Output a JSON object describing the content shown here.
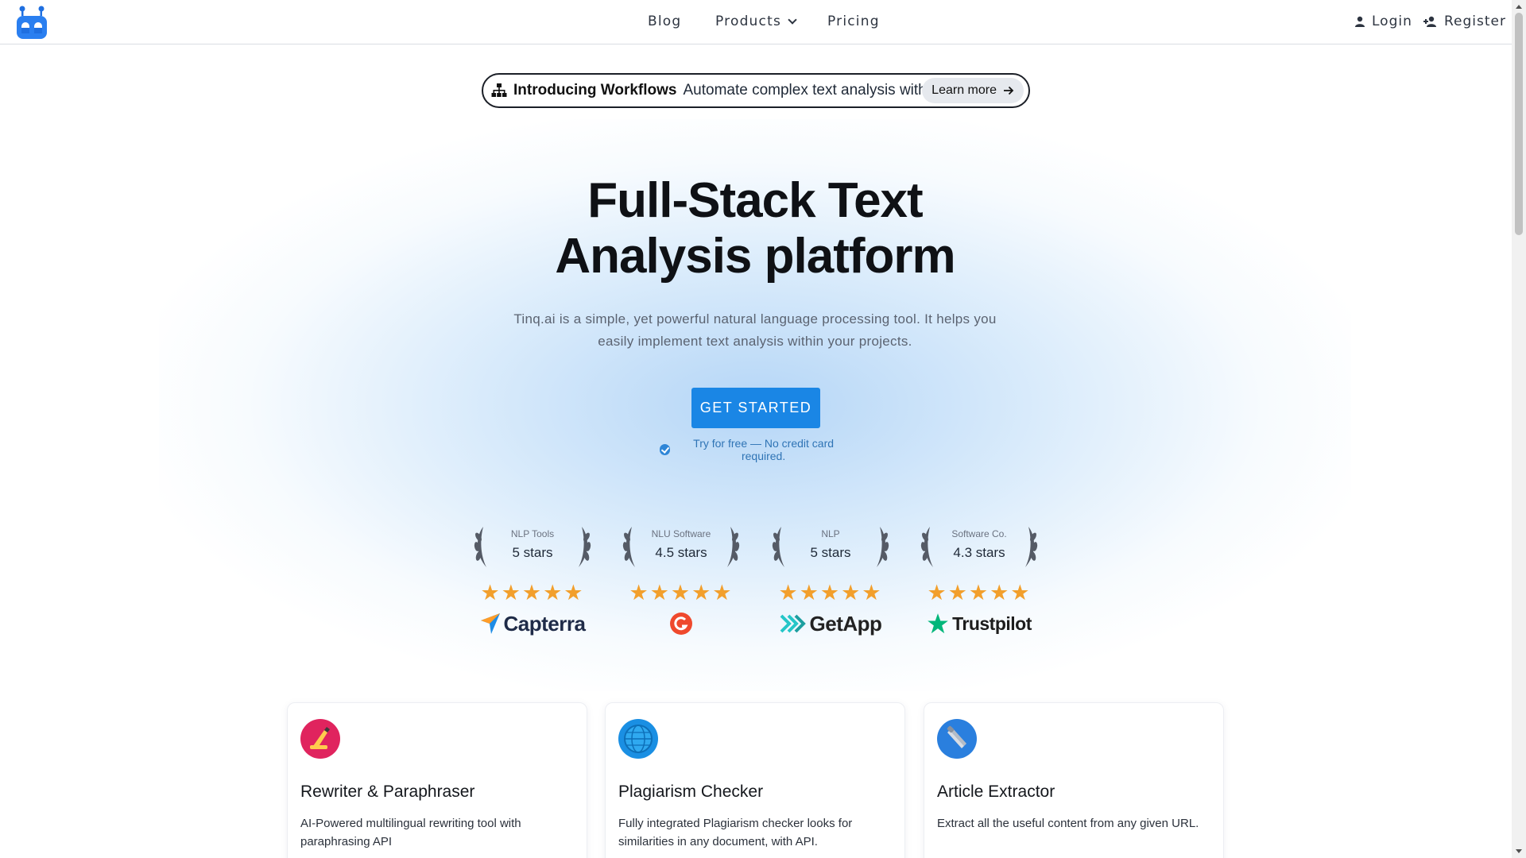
{
  "nav": {
    "items": [
      {
        "label": "Blog"
      },
      {
        "label": "Products"
      },
      {
        "label": "Pricing"
      }
    ],
    "login_label": "Login",
    "register_label": "Register"
  },
  "announcement": {
    "bold": "Introducing Workflows",
    "text": "Automate complex text analysis with ease",
    "button_label": "Learn more"
  },
  "hero": {
    "title_line1": "Full-Stack Text",
    "title_line2": "Analysis platform",
    "subtitle": "Tinq.ai is a simple, yet powerful natural language processing tool. It helps you easily implement text analysis within your projects.",
    "cta_label": "GET STARTED",
    "note": "Try for free — No credit card required."
  },
  "ratings": [
    {
      "category": "NLP Tools",
      "rating": "5 stars",
      "stars": "★★★★★",
      "brand": "Capterra"
    },
    {
      "category": "NLU Software",
      "rating": "4.5 stars",
      "stars": "★★★★★",
      "brand": "G2"
    },
    {
      "category": "NLP",
      "rating": "5 stars",
      "stars": "★★★★★",
      "brand": "GetApp"
    },
    {
      "category": "Software Co.",
      "rating": "4.3 stars",
      "stars": "★★★★★",
      "brand": "Trustpilot"
    }
  ],
  "cards": [
    {
      "title": "Rewriter & Paraphraser",
      "desc": "AI-Powered multilingual rewriting tool with paraphrasing API",
      "icon": "writing-hand-icon",
      "icon_color": "#e0245e"
    },
    {
      "title": "Plagiarism Checker",
      "desc": "Fully integrated Plagiarism checker looks for similarities in any document, with API.",
      "icon": "globe-icon",
      "icon_color": "#1a8fe3"
    },
    {
      "title": "Article Extractor",
      "desc": "Extract all the useful content from any given URL.",
      "icon": "tweezers-icon",
      "icon_color": "#2a7fde"
    }
  ],
  "colors": {
    "accent": "#1a86e5",
    "star": "#f29f2c"
  }
}
